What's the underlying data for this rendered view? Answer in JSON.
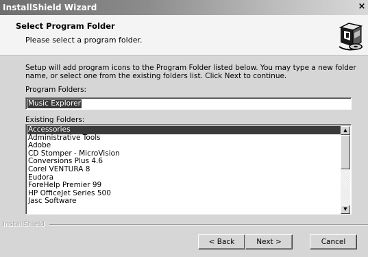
{
  "window": {
    "title": "InstallShield Wizard",
    "close_glyph": "×"
  },
  "header": {
    "title": "Select Program Folder",
    "subtitle": "Please select a program folder.",
    "icon": "installer-box-icon"
  },
  "body": {
    "intro": "Setup will add program icons to the Program Folder listed below.  You may type a new folder name, or select one from the existing folders list.  Click Next to continue.",
    "program_folders_label": "Program Folders:",
    "program_folder_value": "Music Explorer",
    "existing_folders_label": "Existing Folders:",
    "existing_folders": [
      "Accessories",
      "Administrative Tools",
      "Adobe",
      "CD Stomper - MicroVision",
      "Conversions Plus 4.6",
      "Corel VENTURA 8",
      "Eudora",
      "ForeHelp Premier 99",
      "HP OfficeJet Series 500",
      "Jasc Software"
    ],
    "selected_index": 0
  },
  "footer": {
    "brand": "InstallShield",
    "back_label": "< Back",
    "next_label": "Next >",
    "cancel_label": "Cancel"
  },
  "scrollbar": {
    "up_glyph": "▲",
    "down_glyph": "▼"
  },
  "colors": {
    "selection": "#3a3a3a",
    "dialog_face": "#d6d6d6",
    "header_bg": "#f4f4f4"
  }
}
